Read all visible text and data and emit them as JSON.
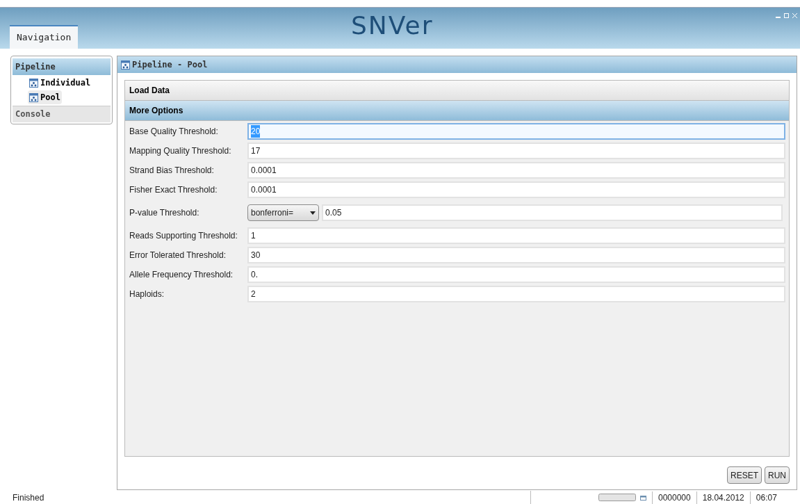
{
  "app": {
    "logo": "SNVer"
  },
  "tabs": [
    {
      "label": "Navigation",
      "selected": true
    }
  ],
  "navigation": {
    "groups": [
      {
        "label": "Pipeline",
        "expanded": true,
        "children": [
          {
            "label": "Individual",
            "selected": false
          },
          {
            "label": "Pool",
            "selected": true
          }
        ]
      },
      {
        "label": "Console",
        "expanded": false
      }
    ]
  },
  "panel": {
    "title": "Pipeline - Pool",
    "sections": [
      {
        "label": "Load Data",
        "expanded": false
      },
      {
        "label": "More Options",
        "expanded": true
      }
    ],
    "fields": [
      {
        "kind": "text",
        "label": "Base Quality Threshold:",
        "value": "20",
        "focused": true
      },
      {
        "kind": "text",
        "label": "Mapping Quality Threshold:",
        "value": "17",
        "focused": false
      },
      {
        "kind": "text",
        "label": "Strand Bias Threshold:",
        "value": "0.0001",
        "focused": false
      },
      {
        "kind": "text",
        "label": "Fisher Exact Threshold:",
        "value": "0.0001",
        "focused": false
      },
      {
        "kind": "select",
        "label": "P-value Threshold:",
        "option": "bonferroni=",
        "value": "0.05",
        "focused": false
      },
      {
        "kind": "text",
        "label": "Reads Supporting Threshold:",
        "value": "1",
        "focused": false
      },
      {
        "kind": "text",
        "label": "Error Tolerated Threshold:",
        "value": "30",
        "focused": false
      },
      {
        "kind": "text",
        "label": "Allele Frequency Threshold:",
        "value": "0.",
        "focused": false
      },
      {
        "kind": "text",
        "label": "Haploids:",
        "value": "2",
        "focused": false
      }
    ],
    "buttons": [
      "RESET",
      "RUN"
    ]
  },
  "status_bar": {
    "message": "Finished",
    "counter": "0000000",
    "date": "18.04.2012",
    "time": "06:07"
  }
}
